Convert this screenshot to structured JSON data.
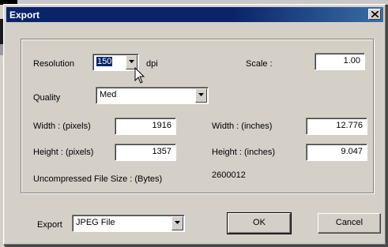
{
  "dialog": {
    "title": "Export"
  },
  "resolution": {
    "label": "Resolution",
    "value": "150",
    "unit": "dpi"
  },
  "scale": {
    "label": "Scale :",
    "value": "1.00"
  },
  "quality": {
    "label": "Quality",
    "value": "Med"
  },
  "width_pixels": {
    "label": "Width : (pixels)",
    "value": "1916"
  },
  "height_pixels": {
    "label": "Height : (pixels)",
    "value": "1357"
  },
  "width_inches": {
    "label": "Width : (inches)",
    "value": "12.776"
  },
  "height_inches": {
    "label": "Height : (inches)",
    "value": "9.047"
  },
  "filesize": {
    "label": "Uncompressed File Size : (Bytes)",
    "value": "2600012"
  },
  "export_format": {
    "label": "Export",
    "value": "JPEG File"
  },
  "buttons": {
    "ok": "OK",
    "cancel": "Cancel"
  },
  "icons": {
    "close": "close-icon",
    "dropdown": "chevron-down-icon",
    "cursor": "mouse-pointer-icon"
  }
}
